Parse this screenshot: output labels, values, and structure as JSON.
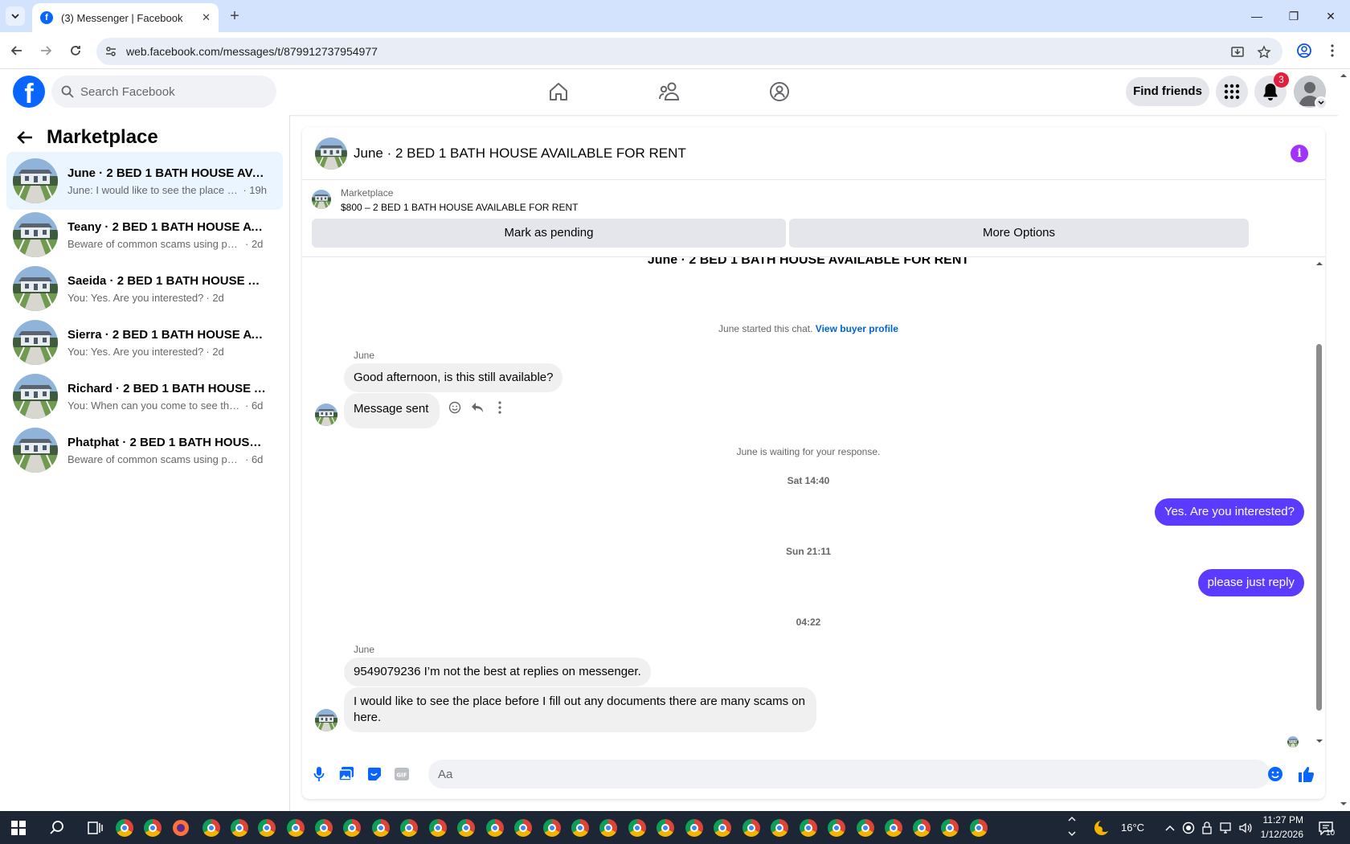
{
  "browser": {
    "tab_title": "(3) Messenger | Facebook",
    "url": "web.facebook.com/messages/t/879912737954977"
  },
  "header": {
    "search_placeholder": "Search Facebook",
    "find_friends_label": "Find friends",
    "notification_count": "3"
  },
  "sidebar": {
    "title": "Marketplace",
    "conversations": [
      {
        "name": "June · 2 BED 1 BATH HOUSE AVAILABLE FOR RENT",
        "snippet": "June: I would like to see the place be...",
        "time": "· 19h",
        "active": true
      },
      {
        "name": "Teany · 2 BED 1 BATH HOUSE AVAILABLE FOR RENT",
        "snippet": "Beware of common scams using pay...",
        "time": "· 2d"
      },
      {
        "name": "Saeida · 2 BED 1 BATH HOUSE AVAILABLE FOR RENT",
        "snippet": "You: Yes. Are you interested?",
        "time": "· 2d"
      },
      {
        "name": "Sierra · 2 BED 1 BATH HOUSE AVAILABLE FOR RENT",
        "snippet": "You: Yes. Are you interested?",
        "time": "· 2d"
      },
      {
        "name": "Richard · 2 BED 1 BATH HOUSE AVAILABLE FOR RENT",
        "snippet": "You: When can you come to see the h...",
        "time": "· 6d"
      },
      {
        "name": "Phatphat · 2 BED 1 BATH HOUSE AVAILABLE FOR RENT",
        "snippet": "Beware of common scams using pay...",
        "time": "· 6d"
      }
    ]
  },
  "chat": {
    "title": "June · 2 BED 1 BATH HOUSE AVAILABLE FOR RENT",
    "listing_source": "Marketplace",
    "listing_title": "$800 – 2 BED 1 BATH HOUSE AVAILABLE FOR RENT",
    "mark_pending_label": "Mark as pending",
    "more_options_label": "More Options",
    "top_title": "June · 2 BED 1 BATH HOUSE AVAILABLE FOR RENT",
    "started_note": "June started this chat.",
    "view_profile_link": "View buyer profile",
    "sender_name": "June",
    "msg1": "Good afternoon, is this still available?",
    "msg2": "Message sent",
    "waiting_note": "June is waiting for your response.",
    "ts1": "Sat 14:40",
    "out1": "Yes. Are you interested?",
    "ts2": "Sun 21:11",
    "out2": "please just reply",
    "ts3": "04:22",
    "sender_name2": "June",
    "msg3": "9549079236 I’m not the best at replies on messenger.",
    "msg4": "I would like to see the place before I fill out any documents there are many scams on here.",
    "composer_placeholder": "Aa"
  },
  "taskbar": {
    "weather": "16°C",
    "time": "11:27 PM",
    "date": "1/12/2026",
    "notif_count": "10"
  },
  "colors": {
    "fb_blue": "#0866ff",
    "outgoing_bubble": "#5b3bff",
    "active_row": "#ebf5ff"
  }
}
